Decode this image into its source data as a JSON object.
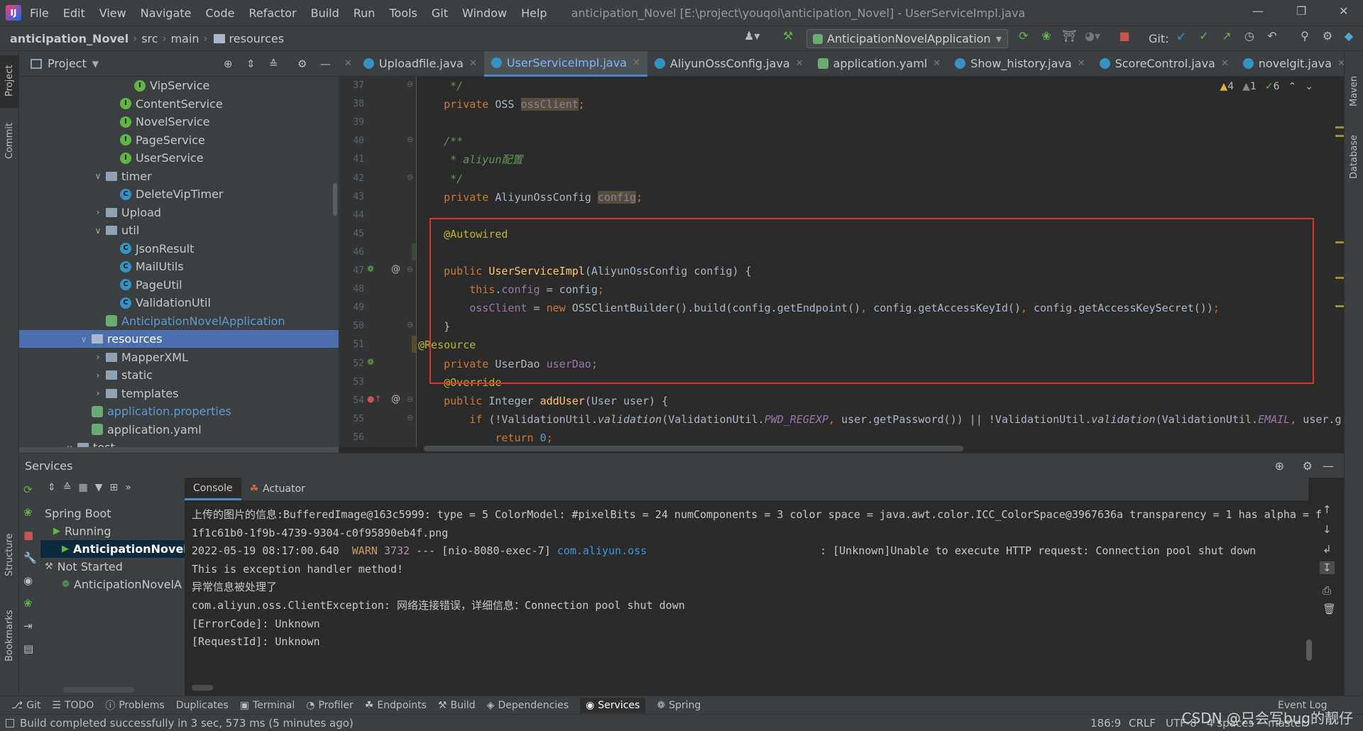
{
  "menubar": {
    "items": [
      "File",
      "Edit",
      "View",
      "Navigate",
      "Code",
      "Refactor",
      "Build",
      "Run",
      "Tools",
      "Git",
      "Window",
      "Help"
    ],
    "window_title": "anticipation_Novel [E:\\project\\youqoi\\anticipation_Novel] - UserServiceImpl.java"
  },
  "navbar": {
    "crumbs": [
      "anticipation_Novel",
      "src",
      "main",
      "resources"
    ],
    "run_config": "AnticipationNovelApplication",
    "git_label": "Git:"
  },
  "left_strip": {
    "project": "Project",
    "commit": "Commit",
    "structure": "Structure",
    "bookmarks": "Bookmarks"
  },
  "right_strip": {
    "maven": "Maven",
    "database": "Database"
  },
  "project": {
    "header": "Project",
    "tree": [
      {
        "label": "VipService",
        "icon": "interface",
        "indent": 3
      },
      {
        "label": "ContentService",
        "icon": "interface",
        "indent": 2
      },
      {
        "label": "NovelService",
        "icon": "interface",
        "indent": 2
      },
      {
        "label": "PageService",
        "icon": "interface",
        "indent": 2
      },
      {
        "label": "UserService",
        "icon": "interface",
        "indent": 2
      },
      {
        "label": "timer",
        "icon": "folder",
        "indent": 1,
        "chev": "open"
      },
      {
        "label": "DeleteVipTimer",
        "icon": "class",
        "indent": 2
      },
      {
        "label": "Upload",
        "icon": "folder",
        "indent": 1,
        "chev": "closed"
      },
      {
        "label": "util",
        "icon": "folder",
        "indent": 1,
        "chev": "open"
      },
      {
        "label": "JsonResult",
        "icon": "class",
        "indent": 2
      },
      {
        "label": "MailUtils",
        "icon": "class",
        "indent": 2
      },
      {
        "label": "PageUtil",
        "icon": "class",
        "indent": 2
      },
      {
        "label": "ValidationUtil",
        "icon": "class",
        "indent": 2
      },
      {
        "label": "AnticipationNovelApplication",
        "icon": "spring",
        "indent": 1,
        "color": "#5b9bd5"
      },
      {
        "label": "resources",
        "icon": "resfolder",
        "indent": 0,
        "chev": "open",
        "selected": true
      },
      {
        "label": "MapperXML",
        "icon": "folder",
        "indent": 1,
        "chev": "closed"
      },
      {
        "label": "static",
        "icon": "folder",
        "indent": 1,
        "chev": "closed"
      },
      {
        "label": "templates",
        "icon": "folder",
        "indent": 1,
        "chev": "closed"
      },
      {
        "label": "application.properties",
        "icon": "spring",
        "indent": 0,
        "color": "#5b9bd5"
      },
      {
        "label": "application.yaml",
        "icon": "spring",
        "indent": 0
      },
      {
        "label": "test",
        "icon": "folder",
        "indent": -1,
        "chev": "open"
      }
    ]
  },
  "tabs": [
    {
      "label": "Uploadfile.java",
      "icon": "class"
    },
    {
      "label": "UserServiceImpl.java",
      "icon": "class",
      "active": true
    },
    {
      "label": "AliyunOssConfig.java",
      "icon": "class"
    },
    {
      "label": "application.yaml",
      "icon": "yaml"
    },
    {
      "label": "Show_history.java",
      "icon": "class"
    },
    {
      "label": "ScoreControl.java",
      "icon": "class"
    },
    {
      "label": "novelgit.java",
      "icon": "class"
    }
  ],
  "inspections": {
    "warn": "4",
    "weak": "1",
    "ok": "6"
  },
  "code": {
    "line_numbers": [
      "37",
      "38",
      "39",
      "40",
      "41",
      "42",
      "43",
      "44",
      "45",
      "46",
      "47",
      "48",
      "49",
      "50",
      "51",
      "52",
      "53",
      "54",
      "55",
      "56"
    ],
    "lines": [
      [
        {
          "t": "     */",
          "c": "cm"
        }
      ],
      [
        {
          "t": "    "
        },
        {
          "t": "private",
          "c": "kw"
        },
        {
          "t": " OSS "
        },
        {
          "t": "ossClient",
          "c": "fd hl"
        },
        {
          "t": ";",
          "c": "kw"
        }
      ],
      [
        {
          "t": ""
        }
      ],
      [
        {
          "t": "    /**",
          "c": "cm"
        }
      ],
      [
        {
          "t": "     * ",
          "c": "cm"
        },
        {
          "t": "aliyun",
          "c": "cm"
        },
        {
          "t": "配置",
          "c": "cm"
        }
      ],
      [
        {
          "t": "     */",
          "c": "cm"
        }
      ],
      [
        {
          "t": "    "
        },
        {
          "t": "private",
          "c": "kw"
        },
        {
          "t": " AliyunOssConfig "
        },
        {
          "t": "config",
          "c": "fd hl"
        },
        {
          "t": ";",
          "c": "kw"
        }
      ],
      [
        {
          "t": ""
        }
      ],
      [
        {
          "t": "    "
        },
        {
          "t": "@Autowired",
          "c": "an"
        }
      ],
      [
        {
          "t": ""
        }
      ],
      [
        {
          "t": "    "
        },
        {
          "t": "public",
          "c": "kw"
        },
        {
          "t": " "
        },
        {
          "t": "UserServiceImpl",
          "c": "fn"
        },
        {
          "t": "(AliyunOssConfig config) {"
        }
      ],
      [
        {
          "t": "        "
        },
        {
          "t": "this",
          "c": "kw"
        },
        {
          "t": "."
        },
        {
          "t": "config",
          "c": "fd"
        },
        {
          "t": " = config"
        },
        {
          "t": ";",
          "c": "kw"
        }
      ],
      [
        {
          "t": "        "
        },
        {
          "t": "ossClient",
          "c": "fd"
        },
        {
          "t": " = "
        },
        {
          "t": "new",
          "c": "kw"
        },
        {
          "t": " OSSClientBuilder().build(config.getEndpoint()"
        },
        {
          "t": ",",
          "c": "kw"
        },
        {
          "t": " config.getAccessKeyId()"
        },
        {
          "t": ",",
          "c": "kw"
        },
        {
          "t": " config.getAccessKeySecret())"
        },
        {
          "t": ";",
          "c": "kw"
        }
      ],
      [
        {
          "t": "    }"
        }
      ],
      [
        {
          "t": "@Resource",
          "c": "an"
        }
      ],
      [
        {
          "t": "    "
        },
        {
          "t": "private",
          "c": "kw"
        },
        {
          "t": " UserDao "
        },
        {
          "t": "userDao",
          "c": "fd"
        },
        {
          "t": ";",
          "c": "kw"
        }
      ],
      [
        {
          "t": "    "
        },
        {
          "t": "@Override",
          "c": "an"
        }
      ],
      [
        {
          "t": "    "
        },
        {
          "t": "public",
          "c": "kw"
        },
        {
          "t": " Integer "
        },
        {
          "t": "addUser",
          "c": "fn"
        },
        {
          "t": "(User user) {"
        }
      ],
      [
        {
          "t": "        "
        },
        {
          "t": "if",
          "c": "kw"
        },
        {
          "t": " (!ValidationUtil."
        },
        {
          "t": "validation",
          "c": "it"
        },
        {
          "t": "(ValidationUtil."
        },
        {
          "t": "PWD_REGEXP",
          "c": "fd it"
        },
        {
          "t": ", ",
          "c": "kw"
        },
        {
          "t": "user.getPassword()) || !ValidationUtil."
        },
        {
          "t": "validation",
          "c": "it"
        },
        {
          "t": "(ValidationUtil."
        },
        {
          "t": "EMAIL",
          "c": "fd it"
        },
        {
          "t": ", ",
          "c": "kw"
        },
        {
          "t": "user.g"
        }
      ],
      [
        {
          "t": "            "
        },
        {
          "t": "return",
          "c": "kw"
        },
        {
          "t": " "
        },
        {
          "t": "0",
          "c": "num"
        },
        {
          "t": ";",
          "c": "kw"
        }
      ]
    ]
  },
  "services": {
    "title": "Services",
    "tree": [
      {
        "label": "Spring Boot",
        "indent": 0
      },
      {
        "label": "Running",
        "indent": 1,
        "icon": "run"
      },
      {
        "label": "AnticipationNovelA",
        "indent": 2,
        "icon": "run",
        "selected": true
      },
      {
        "label": "Not Started",
        "indent": 0,
        "icon": "wrench"
      },
      {
        "label": "AnticipationNovelA",
        "indent": 2,
        "icon": "spring-x"
      }
    ],
    "subtabs": [
      "Console",
      "Actuator"
    ],
    "console": [
      [
        {
          "t": "上传的图片的信息:BufferedImage@163c5999: type = 5 ColorModel: #pixelBits = 24 numComponents = 3 color space = java.awt.color.ICC_ColorSpace@3967636a transparency = 1 has alpha = f"
        }
      ],
      [
        {
          "t": "1f1c61b0-1f9b-4739-9304-c0f95890eb4f.png"
        }
      ],
      [
        {
          "t": "2022-05-19 08:17:00.640  "
        },
        {
          "t": "WARN",
          "c": "warn"
        },
        {
          "t": " "
        },
        {
          "t": "3732",
          "c": "pid"
        },
        {
          "t": " --- [nio-8080-exec-7] "
        },
        {
          "t": "com.aliyun.oss",
          "c": "cls"
        },
        {
          "t": "                           : [Unknown]Unable to execute HTTP request: Connection pool shut down"
        }
      ],
      [
        {
          "t": "This is exception handler method!"
        }
      ],
      [
        {
          "t": "异常信息被处理了"
        }
      ],
      [
        {
          "t": "com.aliyun.oss.ClientException: 网络连接错误，详细信息：Connection pool shut down"
        }
      ],
      [
        {
          "t": "[ErrorCode]: Unknown"
        }
      ],
      [
        {
          "t": "[RequestId]: Unknown"
        }
      ]
    ]
  },
  "bottom_tools": [
    "Git",
    "TODO",
    "Problems",
    "Duplicates",
    "Terminal",
    "Profiler",
    "Endpoints",
    "Build",
    "Dependencies",
    "Services",
    "Spring"
  ],
  "event_log": "Event Log",
  "status": {
    "message": "Build completed successfully in 3 sec, 573 ms (5 minutes ago)",
    "position": "186:9",
    "line_sep": "CRLF",
    "encoding": "UTF-8",
    "indent": "4 spaces",
    "branch": "master"
  },
  "watermark": "CSDN @只会写bug的靓仔"
}
